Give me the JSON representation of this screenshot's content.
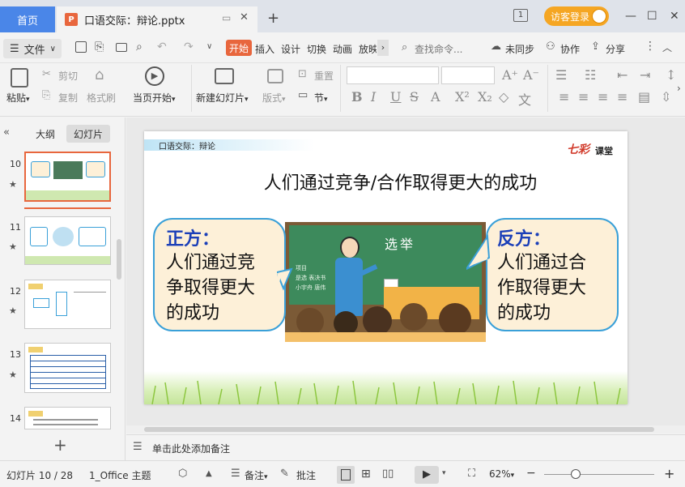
{
  "titlebar": {
    "home_tab": "首页",
    "doc_badge": "P",
    "doc_tab": "口语交际：辩论.pptx",
    "tab_add": "+",
    "page_indicator": "1",
    "login_button": "访客登录",
    "minimize": "—",
    "maximize": "☐",
    "close": "✕"
  },
  "menubar": {
    "file_menu": "文件",
    "tabs": [
      "开始",
      "插入",
      "设计",
      "切换",
      "动画",
      "放映"
    ],
    "search_placeholder": "查找命令...",
    "sync": "未同步",
    "collab": "协作",
    "share": "分享"
  },
  "ribbon": {
    "paste": "粘贴",
    "cut": "剪切",
    "copy": "复制",
    "format_painter": "格式刷",
    "from_current": "当页开始",
    "new_slide": "新建幻灯片",
    "layout": "版式",
    "reset": "重置",
    "section": "节"
  },
  "leftpanel": {
    "tab_outline": "大纲",
    "tab_slides": "幻灯片",
    "thumbnails": [
      {
        "num": "10"
      },
      {
        "num": "11"
      },
      {
        "num": "12"
      },
      {
        "num": "13"
      },
      {
        "num": "14"
      }
    ],
    "add_slide": "+"
  },
  "slide": {
    "header": "口语交际：辩论",
    "logo_main": "七彩",
    "logo_sub": "课堂",
    "title": "人们通过竞争/合作取得更大的成功",
    "pro_label": "正方：",
    "pro_text": [
      "人们通过竞",
      "争取得更大",
      "的成功"
    ],
    "con_label": "反方：",
    "con_text": [
      "人们通过合",
      "作取得更大",
      "的成功"
    ],
    "board_title": "选举",
    "board_lines": [
      "项目",
      "是选  表决书",
      "小宇舟  唐伟"
    ]
  },
  "notes": {
    "placeholder": "单击此处添加备注"
  },
  "statusbar": {
    "slide_info": "幻灯片 10 / 28",
    "theme": "1_Office 主题",
    "notes_btn": "备注",
    "comments_btn": "批注",
    "zoom": "62%"
  },
  "colors": {
    "accent": "#4a86e8",
    "start_tab": "#e8663d",
    "login": "#f5a623",
    "bubble_fill": "#fdf0d8",
    "bubble_border": "#3aa0d8",
    "label_blue": "#1b3fb8"
  }
}
